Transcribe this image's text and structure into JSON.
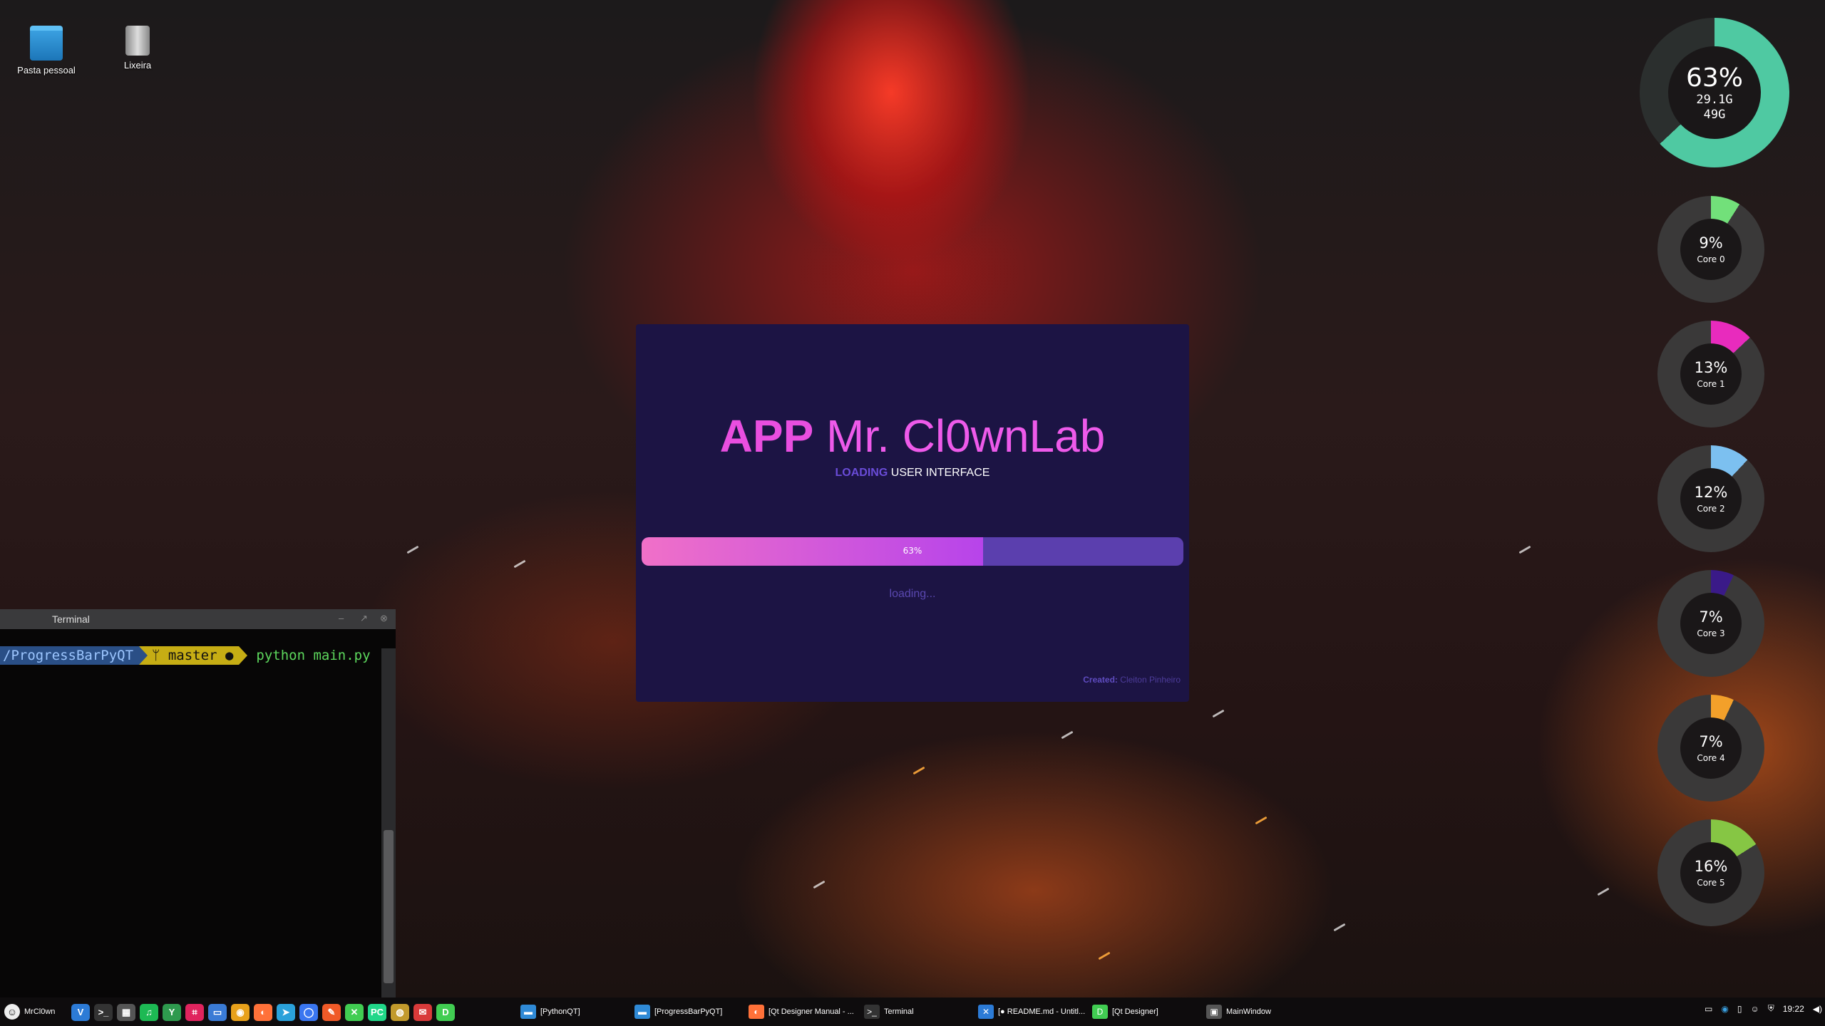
{
  "desktop_icons": [
    {
      "label": "Pasta pessoal",
      "icon": "folder-home-icon"
    },
    {
      "label": "Lixeira",
      "icon": "trash-icon"
    }
  ],
  "memory_gauge": {
    "percent_label": "63%",
    "used": "29.1G",
    "total": "49G",
    "percent": 63,
    "color": "#4fc9a2"
  },
  "cpu_cores": [
    {
      "percent_label": "9%",
      "name": "Core 0",
      "percent": 9,
      "color": "#72e07a"
    },
    {
      "percent_label": "13%",
      "name": "Core 1",
      "percent": 13,
      "color": "#e82bbd"
    },
    {
      "percent_label": "12%",
      "name": "Core 2",
      "percent": 12,
      "color": "#7cc0f0"
    },
    {
      "percent_label": "7%",
      "name": "Core 3",
      "percent": 7,
      "color": "#3a1a88"
    },
    {
      "percent_label": "7%",
      "name": "Core 4",
      "percent": 7,
      "color": "#f3a02a"
    },
    {
      "percent_label": "16%",
      "name": "Core 5",
      "percent": 16,
      "color": "#86c644"
    }
  ],
  "splash": {
    "title_bold": "APP",
    "title_rest": "Mr. Cl0wnLab",
    "subtitle_highlight": "LOADING",
    "subtitle_rest": "USER INTERFACE",
    "progress_label": "63%",
    "progress": 0.63,
    "status": "loading...",
    "credit_label": "Created:",
    "credit_name": "Cleiton Pinheiro"
  },
  "terminal": {
    "title": "Terminal",
    "path": "/ProgressBarPyQT",
    "branch": "ᛘ master ●",
    "command": "python main.py",
    "controls": [
      "–",
      "↗",
      "⊗"
    ]
  },
  "taskbar": {
    "user": "MrCl0wn",
    "launchers": [
      {
        "name": "vscode",
        "glyph": "V",
        "color": "#2c7bd6"
      },
      {
        "name": "terminal",
        "glyph": ">_",
        "color": "#333"
      },
      {
        "name": "monitor",
        "glyph": "▦",
        "color": "#555"
      },
      {
        "name": "spotify",
        "glyph": "♫",
        "color": "#1db954"
      },
      {
        "name": "app",
        "glyph": "Y",
        "color": "#2e9a4e"
      },
      {
        "name": "screenshot",
        "glyph": "⌗",
        "color": "#e0245e"
      },
      {
        "name": "files",
        "glyph": "▭",
        "color": "#3a7bd5"
      },
      {
        "name": "chrome",
        "glyph": "◉",
        "color": "#e8a11b"
      },
      {
        "name": "firefox",
        "glyph": "◐",
        "color": "#ff7139"
      },
      {
        "name": "telegram",
        "glyph": "➤",
        "color": "#2aa1da"
      },
      {
        "name": "signal",
        "glyph": "◯",
        "color": "#3a76f0"
      },
      {
        "name": "editor",
        "glyph": "✎",
        "color": "#f05a28"
      },
      {
        "name": "qtcreator",
        "glyph": "✕",
        "color": "#41cd52"
      },
      {
        "name": "pycharm",
        "glyph": "PC",
        "color": "#21d789"
      },
      {
        "name": "gimp",
        "glyph": "◍",
        "color": "#c29a2c"
      },
      {
        "name": "chat",
        "glyph": "✉",
        "color": "#d83a3a"
      },
      {
        "name": "designer",
        "glyph": "D",
        "color": "#41cd52"
      }
    ],
    "tasks": [
      {
        "label": "[PythonQT]",
        "glyph": "▬",
        "color": "#2f8ad6"
      },
      {
        "label": "[ProgressBarPyQT]",
        "glyph": "▬",
        "color": "#2f8ad6"
      },
      {
        "label": "[Qt Designer Manual - ...",
        "glyph": "◐",
        "color": "#ff7139"
      },
      {
        "label": "Terminal",
        "glyph": ">_",
        "color": "#333"
      },
      {
        "label": "[● README.md - Untitl...",
        "glyph": "✕",
        "color": "#2c7bd6"
      },
      {
        "label": "[Qt Designer]",
        "glyph": "D",
        "color": "#41cd52"
      },
      {
        "label": "MainWindow",
        "glyph": "▣",
        "color": "#555"
      }
    ],
    "tray": {
      "clock": "19:22"
    }
  }
}
